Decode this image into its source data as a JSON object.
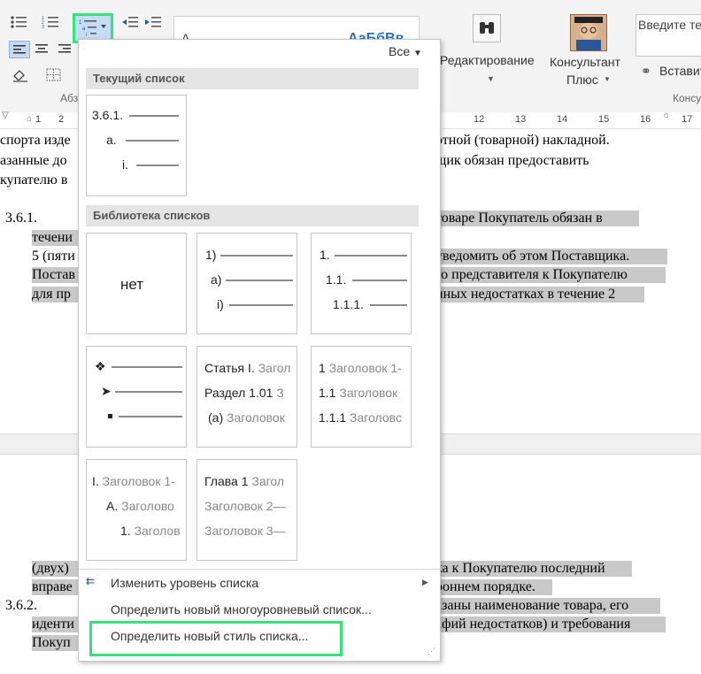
{
  "ribbon": {
    "group_label_paragraph": "Абз",
    "editing_label": "Редактирование",
    "consultant_label_1": "Консультант",
    "consultant_label_2": "Плюс",
    "consultant_group_label": "Консу",
    "search_placeholder": "Введите те",
    "insert_label": "Вставит",
    "styles_preview": "АаБбВв"
  },
  "ruler": {
    "ticks_left": [
      "1",
      "2"
    ],
    "ticks_right": [
      "12",
      "13",
      "14",
      "15",
      "16",
      "17"
    ]
  },
  "document": {
    "line1_left": "спорта изде",
    "line1_right": "отной (товарной) накладной.",
    "line2_left": "азанные до",
    "line2_right": "щик обязан предоставить",
    "line3_left": "купателю в",
    "item_361": "3.6.1.",
    "line4_right": "товаре Покупатель обязан в",
    "line5_left": "течени",
    "line6_left": "5 (пяти",
    "line6_right": "уведомить об этом Поставщика.",
    "line7_left": "Постав",
    "line7_right": "го представителя к Покупателю",
    "line8_left": "для пр",
    "line8_right": "нных недостатках в течение 2",
    "line9_left": "(двух)",
    "line9_right": "ка к Покупателю последний",
    "line10_left": "вправе",
    "line10_right": "роннем порядке.",
    "item_362": "3.6.2.",
    "line11_right": "азаны наименование товара, его",
    "line12_left": "иденти",
    "line12_right": "афий недостатков) и требования",
    "line13_left": "Покуп"
  },
  "dropdown": {
    "filter_label": "Все",
    "current_list_header": "Текущий список",
    "library_header": "Библиотека списков",
    "current_list": [
      "3.6.1.",
      "a.",
      "i."
    ],
    "none_label": "нет",
    "tile_paren": [
      "1)",
      "a)",
      "i)"
    ],
    "tile_decimal": [
      "1.",
      "1.1.",
      "1.1.1."
    ],
    "tile_article": {
      "line1_prefix": "Статья I.",
      "line1_suffix": "Загол",
      "line2_prefix": "Раздел 1.01",
      "line2_suffix": "З",
      "line3_prefix": "(a)",
      "line3_suffix": "Заголовок"
    },
    "tile_heading_decimal": {
      "line1_prefix": "1",
      "line1_suffix": "Заголовок 1-",
      "line2_prefix": "1.1",
      "line2_suffix": "Заголовок",
      "line3_prefix": "1.1.1",
      "line3_suffix": "Заголовс"
    },
    "tile_heading_roman": {
      "line1_prefix": "I.",
      "line1_suffix": "Заголовок 1-",
      "line2_prefix": "A.",
      "line2_suffix": "Заголово",
      "line3_prefix": "1.",
      "line3_suffix": "Заголов"
    },
    "tile_chapter": {
      "line1_prefix": "Глава 1",
      "line1_suffix": "Загол",
      "line2": "Заголовок 2—",
      "line3": "Заголовок 3—"
    },
    "menu": {
      "change_level": "Изменить уровень списка",
      "define_multilevel": "Определить новый многоуровневый список...",
      "define_style": "Определить новый стиль списка..."
    },
    "highlight_color": "#35e37a"
  }
}
